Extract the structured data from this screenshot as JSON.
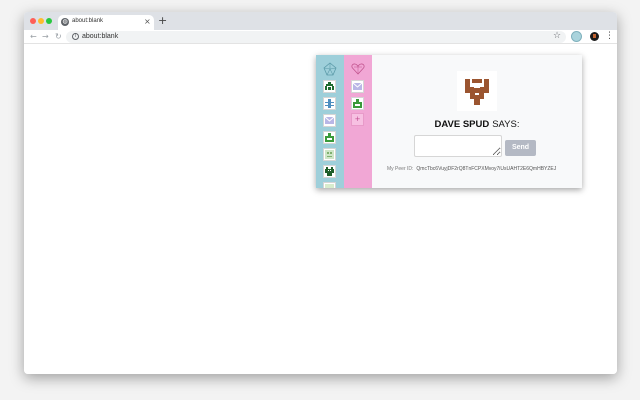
{
  "tab": {
    "title": "about:blank",
    "close_glyph": "×",
    "favicon": "globe-icon"
  },
  "new_tab_glyph": "+",
  "toolbar": {
    "back_glyph": "←",
    "forward_glyph": "→",
    "reload_glyph": "↻",
    "url": "about:blank",
    "star_glyph": "☆",
    "menu_glyph": "⋮"
  },
  "popup": {
    "colors": {
      "blue_column": "#9ecfda",
      "pink_column": "#f1a7d5",
      "send_button": "#b4b9c4",
      "avatar_brown": "#9b5530"
    },
    "plus_label": "+",
    "user": {
      "name": "DAVE SPUD",
      "says": "SAYS:"
    },
    "send_label": "Send",
    "peer_id_label": "My Peer ID:",
    "peer_id_value": "QmcTbc6VuyjDF2rQ8TnFCPXMvoy7iUsUAHT2E6QmHBYZEJ"
  }
}
